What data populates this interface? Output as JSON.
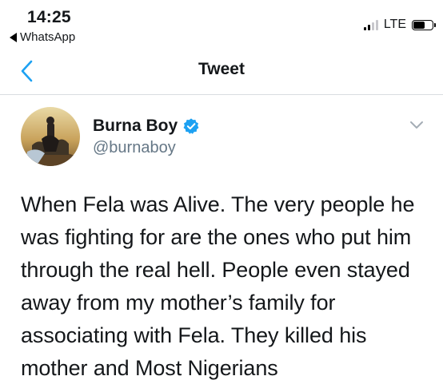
{
  "status_bar": {
    "time": "14:25",
    "back_app": "WhatsApp",
    "network": "LTE",
    "signal_bars": 2,
    "battery_level": 0.62
  },
  "nav": {
    "title": "Tweet"
  },
  "tweet": {
    "author_name": "Burna Boy",
    "author_handle": "@burnaboy",
    "verified": true,
    "text": "When Fela was Alive. The very people he was fighting for are the ones who put him through the real hell. People even stayed away from my mother’s family for associating with Fela. They killed his mother and Most Nigerians"
  },
  "colors": {
    "twitter_blue": "#1da1f2",
    "handle_gray": "#657786",
    "text": "#14171a"
  },
  "icons": {
    "back": "chevron-left",
    "verified": "verified-badge",
    "more": "chevron-down"
  }
}
